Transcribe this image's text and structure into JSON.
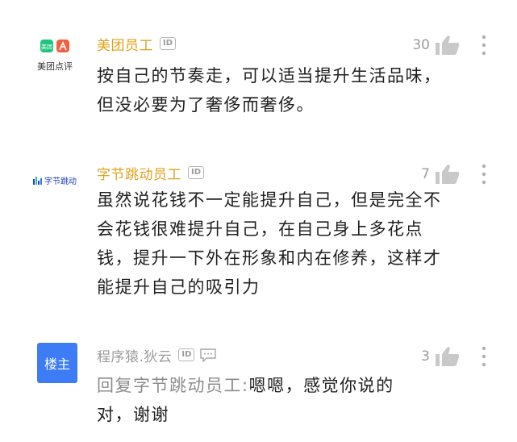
{
  "comments": [
    {
      "user": "美团员工",
      "badge": "ID",
      "org_logo_text": "美团点评",
      "likes": "30",
      "text": "按自己的节奏走，可以适当提升生活品味，但没必要为了奢侈而奢侈。"
    },
    {
      "user": "字节跳动员工",
      "badge": "ID",
      "org_logo_text": "字节跳动",
      "likes": "7",
      "text": "虽然说花钱不一定能提升自己，但是完全不会花钱很难提升自己，在自己身上多花点钱，提升一下外在形象和内在修养，这样才能提升自己的吸引力"
    },
    {
      "user": "程序猿.狄云",
      "badge": "ID",
      "owner_tag": "楼主",
      "likes": "3",
      "reply_prefix": "回复字节跳动员工:",
      "text": "嗯嗯，感觉你说的对，谢谢"
    }
  ],
  "colors": {
    "name_gold": "#e0a21b",
    "owner_blue": "#3d7cf5",
    "meituan_green": "#1fc57e",
    "meituan_orange": "#f25f3e",
    "bytedance_blue": "#1e3fbf"
  },
  "icons": [
    "thumbs-up-icon",
    "more-vertical-icon",
    "reply-bubble-icon"
  ]
}
